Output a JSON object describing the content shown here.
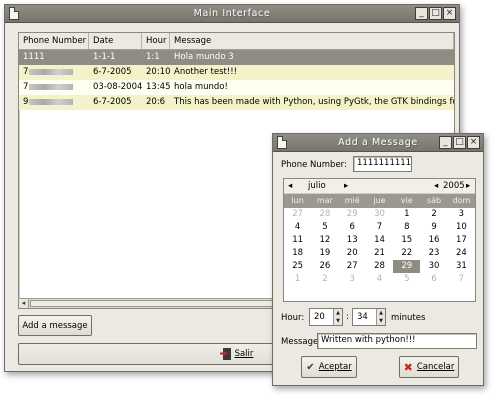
{
  "main_window": {
    "title": "Main Interface",
    "window_buttons": [
      "_",
      "□",
      "×"
    ],
    "table": {
      "columns": [
        "Phone Number",
        "Date",
        "Hour",
        "Message"
      ],
      "rows": [
        {
          "phone": "1111",
          "date": "1-1-1",
          "hour": "1:1",
          "message": "Hola mundo 3"
        },
        {
          "phone": "7",
          "date": "6-7-2005",
          "hour": "20:10",
          "message": "Another test!!!"
        },
        {
          "phone": "7",
          "date": "03-08-2004",
          "hour": "13:45",
          "message": "hola mundo!"
        },
        {
          "phone": "9",
          "date": "6-7-2005",
          "hour": "20:6",
          "message": "This has been made with Python, using PyGtk, the GTK bindings for G"
        }
      ]
    },
    "add_message_label": "Add a message",
    "salir_label": "Salir"
  },
  "dialog": {
    "title": "Add a Message",
    "window_buttons": [
      "_",
      "□",
      "×"
    ],
    "phone_label": "Phone Number:",
    "phone_value": "1111111111",
    "calendar": {
      "month": "julio",
      "year": "2005",
      "prev": "◂",
      "next": "▸",
      "weekdays": [
        "lun",
        "mar",
        "mié",
        "jue",
        "vie",
        "sáb",
        "dom"
      ],
      "days": [
        [
          "27",
          "28",
          "29",
          "30",
          "1",
          "2",
          "3"
        ],
        [
          "4",
          "5",
          "6",
          "7",
          "8",
          "9",
          "10"
        ],
        [
          "11",
          "12",
          "13",
          "14",
          "15",
          "16",
          "17"
        ],
        [
          "18",
          "19",
          "20",
          "21",
          "22",
          "23",
          "24"
        ],
        [
          "25",
          "26",
          "27",
          "28",
          "29",
          "30",
          "31"
        ],
        [
          "1",
          "2",
          "3",
          "4",
          "5",
          "6",
          "7"
        ]
      ],
      "selected_day": "29"
    },
    "hour_label": "Hour:",
    "hour_value": "20",
    "separator": ":",
    "minute_value": "34",
    "minutes_label": "minutes",
    "message_label": "Message",
    "message_value": "Written with python!!!",
    "accept_label": "Aceptar",
    "cancel_label": "Cancelar"
  },
  "colors": {
    "selection": "#8e8c83",
    "row_alt": "#f4f2c8",
    "window_bg": "#ebe9e1",
    "titlebar": "#8f8d84"
  }
}
